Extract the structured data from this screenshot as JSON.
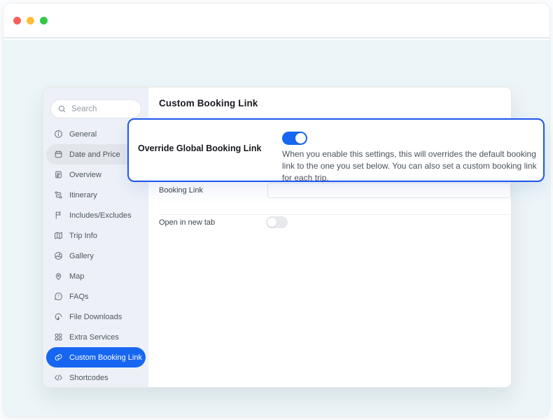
{
  "window": {
    "traffic_lights": [
      "close",
      "minimize",
      "maximize"
    ]
  },
  "sidebar": {
    "search": {
      "placeholder": "Search"
    },
    "items": [
      {
        "label": "General",
        "icon": "info",
        "state": "normal"
      },
      {
        "label": "Date and Price",
        "icon": "calendar",
        "state": "highlighted"
      },
      {
        "label": "Overview",
        "icon": "document",
        "state": "normal"
      },
      {
        "label": "Itinerary",
        "icon": "route",
        "state": "normal"
      },
      {
        "label": "Includes/Excludes",
        "icon": "flag",
        "state": "normal"
      },
      {
        "label": "Trip Info",
        "icon": "map",
        "state": "normal"
      },
      {
        "label": "Gallery",
        "icon": "image",
        "state": "normal"
      },
      {
        "label": "Map",
        "icon": "pin",
        "state": "normal"
      },
      {
        "label": "FAQs",
        "icon": "question-bubble",
        "state": "normal"
      },
      {
        "label": "File Downloads",
        "icon": "download-cloud",
        "state": "normal"
      },
      {
        "label": "Extra Services",
        "icon": "grid",
        "state": "normal"
      },
      {
        "label": "Custom Booking Link",
        "icon": "link",
        "state": "active"
      },
      {
        "label": "Shortcodes",
        "icon": "code",
        "state": "normal"
      }
    ]
  },
  "main": {
    "title": "Custom Booking Link",
    "override": {
      "label": "Override Global Booking Link",
      "enabled": true,
      "help": "When you enable this settings, this will overrides the default booking link to the one you set below. You can also set a custom booking link for each trip."
    },
    "fields": {
      "booking_link": {
        "label": "Booking Link",
        "value": ""
      },
      "open_new_tab": {
        "label": "Open in new tab",
        "enabled": false
      }
    }
  },
  "colors": {
    "accent_blue": "#1766f2",
    "callout_border": "#1d55ec",
    "content_bg": "#ecf5f8",
    "sidebar_bg": "#edf1f7",
    "traffic_red": "#f6605a",
    "traffic_yellow": "#fbbe3c",
    "traffic_green": "#32c748"
  }
}
